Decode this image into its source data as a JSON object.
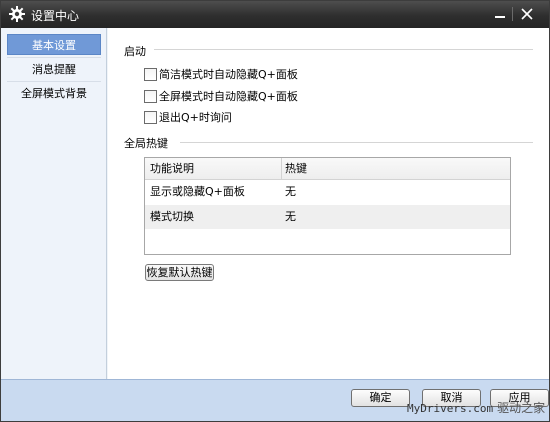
{
  "window": {
    "title": "设置中心"
  },
  "sidebar": {
    "items": [
      {
        "label": "基本设置",
        "active": true
      },
      {
        "label": "消息提醒",
        "active": false
      },
      {
        "label": "全屏模式背景",
        "active": false
      }
    ]
  },
  "startup": {
    "title": "启动",
    "options": [
      {
        "label": "简洁模式时自动隐藏Q+面板",
        "checked": false
      },
      {
        "label": "全屏模式时自动隐藏Q+面板",
        "checked": false
      },
      {
        "label": "退出Q+时询问",
        "checked": false
      }
    ]
  },
  "hotkeys": {
    "title": "全局热键",
    "columns": [
      "功能说明",
      "热键"
    ],
    "rows": [
      {
        "function": "显示或隐藏Q+面板",
        "key": "无"
      },
      {
        "function": "模式切换",
        "key": "无"
      }
    ],
    "restore_label": "恢复默认热键"
  },
  "footer": {
    "ok_label": "确定",
    "cancel_label": "取消",
    "apply_label": "应用"
  },
  "watermark": {
    "site": "MyDrivers.com",
    "brand": "驱动之家"
  },
  "colors": {
    "titlebar": "#2e2e2e",
    "nav_active": "#7099d7",
    "footer": "#c9daf0"
  }
}
